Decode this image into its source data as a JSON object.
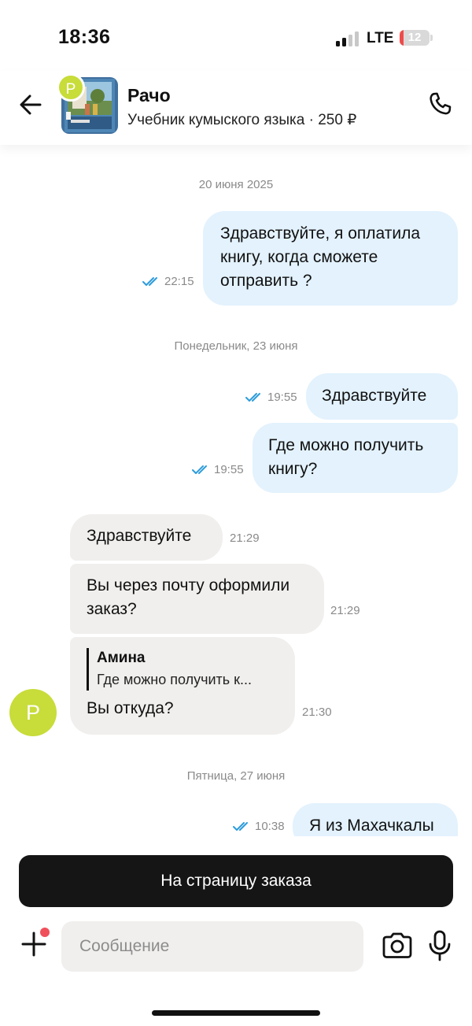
{
  "status_bar": {
    "time": "18:36",
    "network": "LTE",
    "battery": "12",
    "battery_level_percent": 12
  },
  "header": {
    "seller_name": "Рачо",
    "seller_initial": "P",
    "product": "Учебник кумыского языка · 250 ₽",
    "icons": {
      "back": "arrow-left-icon",
      "call": "phone-icon"
    }
  },
  "messages": {
    "date_1": "20 июня 2025",
    "m1": {
      "text": "Здравствуйте, я оплатила книгу, когда сможете отправить ?",
      "time": "22:15"
    },
    "date_2": "Понедельник, 23 июня",
    "m2": {
      "text": "Здравствуйте",
      "time": "19:55"
    },
    "m3": {
      "text": "Где можно получить книгу?",
      "time": "19:55"
    },
    "m4": {
      "text": "Здравствуйте",
      "time": "21:29"
    },
    "m5": {
      "text": "Вы через почту оформили заказ?",
      "time": "21:29"
    },
    "m6": {
      "reply_author": "Амина",
      "reply_text": "Где можно получить к...",
      "text": "Вы откуда?",
      "time": "21:30"
    },
    "avatar_initial": "P",
    "date_3": "Пятница, 27 июня",
    "m7": {
      "text": "Я из Махачкалы",
      "time": "10:38"
    }
  },
  "bottom": {
    "order_button": "На страницу заказа",
    "input_placeholder": "Сообщение",
    "icons": {
      "attach": "plus-icon",
      "camera": "camera-icon",
      "mic": "microphone-icon"
    }
  },
  "colors": {
    "outgoing_bubble": "#e3f2fd",
    "incoming_bubble": "#f0efed",
    "read_check": "#2d9cdb",
    "avatar": "#c8dc3a",
    "order_button": "#151515"
  }
}
